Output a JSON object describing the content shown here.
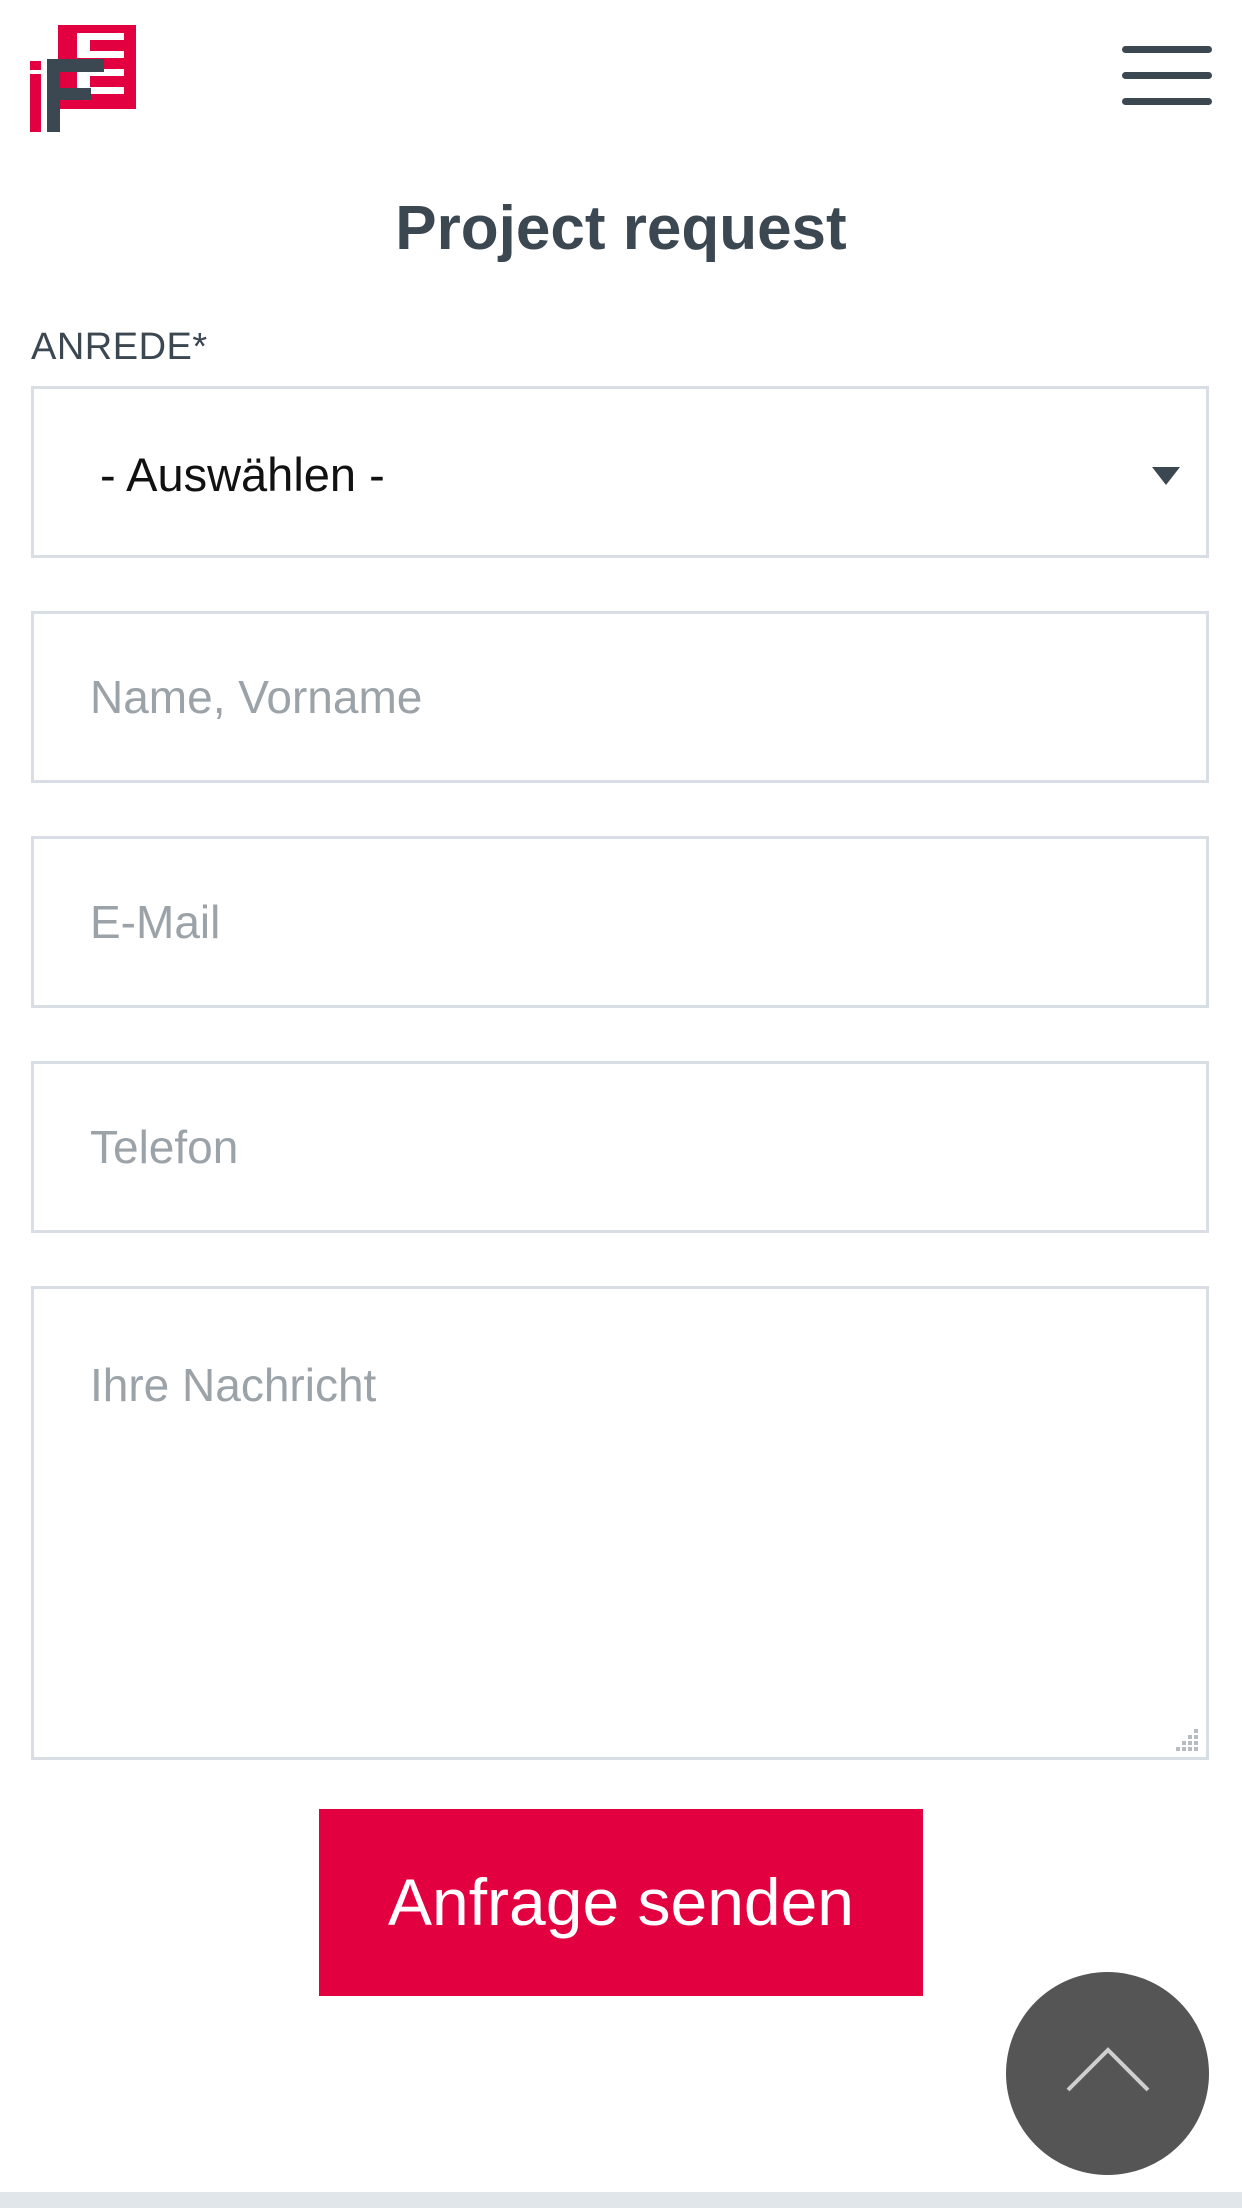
{
  "header": {
    "logo_text": "iFB",
    "logo_color": "#e30040",
    "logo_dark_color": "#3b4751",
    "menu_icon": "hamburger-menu-icon"
  },
  "page": {
    "title": "Project request"
  },
  "form": {
    "salutation": {
      "label": "ANREDE*",
      "selected_value": "- Auswählen -",
      "icon": "dropdown-triangle-icon"
    },
    "name": {
      "placeholder": "Name, Vorname",
      "value": ""
    },
    "email": {
      "placeholder": "E-Mail",
      "value": ""
    },
    "phone": {
      "placeholder": "Telefon",
      "value": ""
    },
    "message": {
      "placeholder": "Ihre Nachricht",
      "value": ""
    },
    "submit_label": "Anfrage senden"
  },
  "scroll_top": {
    "icon": "chevron-up-icon"
  },
  "colors": {
    "accent": "#e30040",
    "text": "#3b4751",
    "placeholder": "#9ba3a9",
    "border": "#d8dee3",
    "scroll_button": "#555555"
  }
}
